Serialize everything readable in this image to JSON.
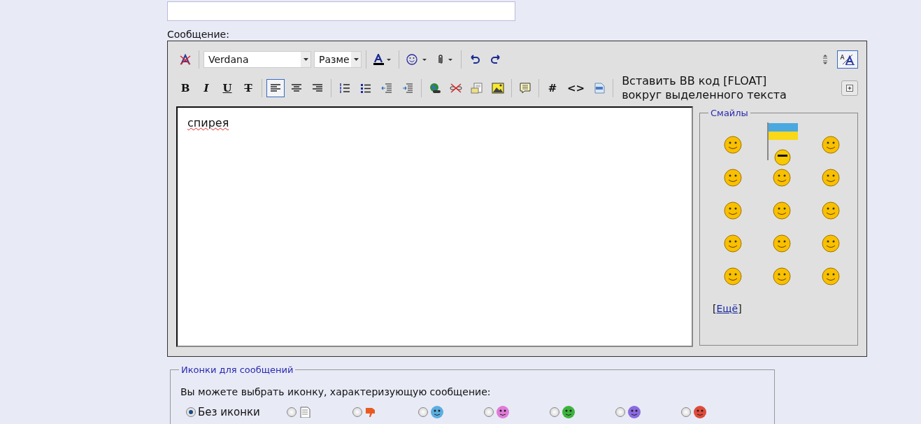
{
  "message_label": "Сообщение:",
  "toolbar_row_1": [
    {
      "kind": "remove-format",
      "selected": false
    },
    {
      "kind": "separator"
    },
    {
      "kind": "font-select",
      "value": "Verdana"
    },
    {
      "kind": "size-select",
      "value": "Разме"
    },
    {
      "kind": "separator"
    },
    {
      "kind": "text-color",
      "selected": false
    },
    {
      "kind": "separator"
    },
    {
      "kind": "smiley-menu",
      "selected": false
    },
    {
      "kind": "attach-menu",
      "selected": false
    },
    {
      "kind": "separator"
    },
    {
      "kind": "undo",
      "selected": false
    },
    {
      "kind": "redo",
      "selected": false
    }
  ],
  "toolbar_row_1_right": [
    {
      "kind": "resize",
      "selected": false
    },
    {
      "kind": "font-style",
      "selected": true
    }
  ],
  "toolbar_row_2": [
    {
      "kind": "bold",
      "label": "B",
      "selected": false
    },
    {
      "kind": "italic",
      "label": "I",
      "selected": false
    },
    {
      "kind": "underline",
      "label": "U",
      "selected": false
    },
    {
      "kind": "strike",
      "label": "T",
      "selected": false
    },
    {
      "kind": "separator"
    },
    {
      "kind": "align-left",
      "selected": true
    },
    {
      "kind": "align-center",
      "selected": false
    },
    {
      "kind": "align-right",
      "selected": false
    },
    {
      "kind": "separator"
    },
    {
      "kind": "ordered-list",
      "selected": false
    },
    {
      "kind": "bullet-list",
      "selected": false
    },
    {
      "kind": "outdent",
      "selected": false
    },
    {
      "kind": "indent",
      "selected": false
    },
    {
      "kind": "separator"
    },
    {
      "kind": "link",
      "selected": false
    },
    {
      "kind": "unlink",
      "selected": false
    },
    {
      "kind": "attachment",
      "selected": false
    },
    {
      "kind": "image",
      "selected": false
    },
    {
      "kind": "separator"
    },
    {
      "kind": "quote",
      "selected": false
    },
    {
      "kind": "separator"
    },
    {
      "kind": "hash",
      "label": "#",
      "selected": false
    },
    {
      "kind": "code",
      "label": "<>",
      "selected": false
    },
    {
      "kind": "php",
      "selected": false
    },
    {
      "kind": "separator"
    }
  ],
  "hint": "Вставить BB код [FLOAT] вокруг выделенного текста",
  "message_text": "спирея",
  "smilies": {
    "title": "Смайлы",
    "more_open": "[",
    "more_link": "Ещё",
    "more_close": "]"
  },
  "post_icons": {
    "title": "Иконки для сообщений",
    "prompt": "Вы можете выбрать иконку, характеризующую сообщение:",
    "options": [
      {
        "kind": "none",
        "label": "Без иконки",
        "selected": true
      },
      {
        "kind": "document",
        "selected": false
      },
      {
        "kind": "thumb-down",
        "selected": false
      },
      {
        "kind": "face",
        "color": "#5aaee0",
        "selected": false
      },
      {
        "kind": "face",
        "color": "#e07ad8",
        "selected": false
      },
      {
        "kind": "face",
        "color": "#3cb43c",
        "selected": false
      },
      {
        "kind": "face",
        "color": "#8a6ae0",
        "selected": false
      },
      {
        "kind": "face",
        "color": "#e04a3a",
        "selected": false
      }
    ]
  }
}
